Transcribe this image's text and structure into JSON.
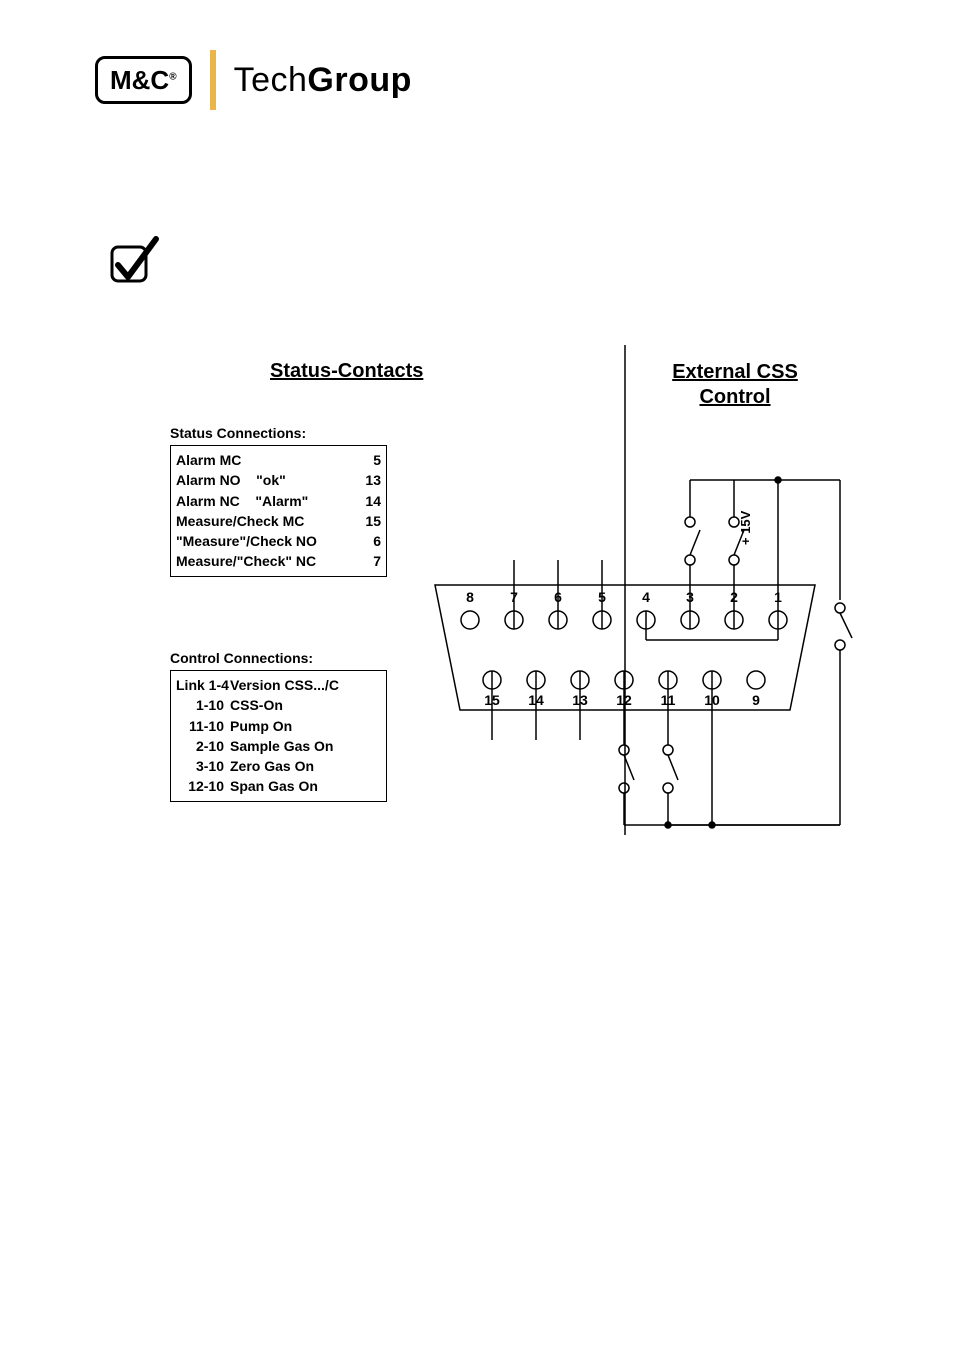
{
  "header": {
    "logo_text": "M&C",
    "logo_reg": "®",
    "brand_thin": "Tech",
    "brand_bold": "Group"
  },
  "titles": {
    "status_contacts": "Status-Contacts",
    "external_css_control": "External CSS Control"
  },
  "status": {
    "heading": "Status Connections:",
    "rows": [
      {
        "label": "Alarm MC",
        "pin": "5"
      },
      {
        "label": "Alarm NO    \"ok\"",
        "pin": "13"
      },
      {
        "label": "Alarm NC    \"Alarm\"",
        "pin": "14"
      },
      {
        "label": "Measure/Check MC",
        "pin": "15"
      },
      {
        "label": "\"Measure\"/Check NO",
        "pin": "6"
      },
      {
        "label": "Measure/\"Check\" NC",
        "pin": "7"
      }
    ]
  },
  "control": {
    "heading": "Control Connections:",
    "rows": [
      {
        "link": "Link 1-4",
        "desc": "Version CSS.../C"
      },
      {
        "link": "1-10",
        "desc": "CSS-On"
      },
      {
        "link": "11-10",
        "desc": "Pump On"
      },
      {
        "link": "2-10",
        "desc": "Sample Gas On"
      },
      {
        "link": "3-10",
        "desc": "Zero Gas On"
      },
      {
        "link": "12-10",
        "desc": "Span Gas On"
      }
    ]
  },
  "connector": {
    "top_pins": [
      "8",
      "7",
      "6",
      "5",
      "4",
      "3",
      "2",
      "1"
    ],
    "bottom_pins": [
      "15",
      "14",
      "13",
      "12",
      "11",
      "10",
      "9"
    ],
    "voltage_label": "+ 15V"
  }
}
